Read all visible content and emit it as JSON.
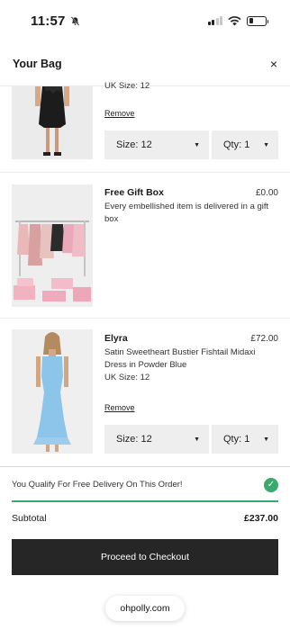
{
  "status_bar": {
    "time": "11:57"
  },
  "header": {
    "title": "Your Bag",
    "close": "×"
  },
  "items": [
    {
      "size_line": "UK Size: 12",
      "remove": "Remove",
      "size_select": "Size: 12",
      "qty_select": "Qty: 1"
    },
    {
      "name": "Free Gift Box",
      "price": "£0.00",
      "description": "Every embellished item is delivered in a gift box"
    },
    {
      "name": "Elyra",
      "price": "£72.00",
      "description": "Satin Sweetheart Bustier Fishtail Midaxi Dress in Powder Blue",
      "size_line": "UK Size: 12",
      "remove": "Remove",
      "size_select": "Size: 12",
      "qty_select": "Qty: 1"
    }
  ],
  "delivery": {
    "text": "You Qualify For Free Delivery On This Order!",
    "status_color": "#3aa96c"
  },
  "subtotal": {
    "label": "Subtotal",
    "value": "£237.00"
  },
  "checkout": {
    "label": "Proceed to Checkout"
  },
  "browser": {
    "url": "ohpolly.com"
  },
  "icons": [
    "muted-bell-icon",
    "signal-icon",
    "wifi-icon",
    "battery-icon",
    "close-icon",
    "caret-down-icon",
    "check-icon"
  ]
}
